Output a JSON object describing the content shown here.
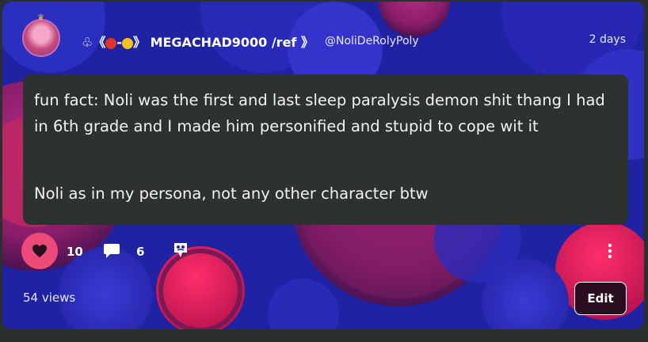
{
  "post": {
    "display_name_prefix": "♧《",
    "display_name_sep": "-",
    "display_name_suffix": "》 MEGACHAD9000 /ref 》",
    "handle": "@NoliDeRolyPoly",
    "timestamp": "2 days",
    "paragraphs": [
      "fun fact: Noli was the first and last sleep paralysis demon shit thang I had in 6th grade and I made him personified and stupid to cope wit it",
      "Noli as in my persona, not any other character btw"
    ]
  },
  "actions": {
    "likes": "10",
    "comments": "6"
  },
  "footer": {
    "views": "54 views",
    "edit_label": "Edit"
  },
  "colors": {
    "background": "#1e1f9e",
    "like": "#ec4a78",
    "content_box": "#2d312f",
    "dot_red": "#e0332c",
    "dot_yellow": "#f2c320"
  }
}
